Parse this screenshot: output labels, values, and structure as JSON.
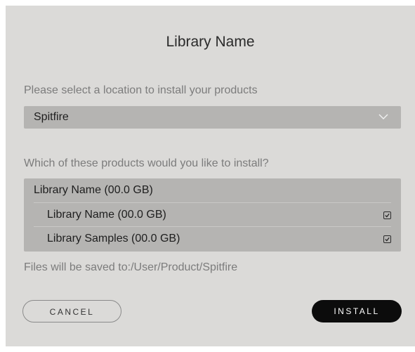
{
  "dialog": {
    "title": "Library Name",
    "location_prompt": "Please select a location to install your products",
    "location_select": {
      "value": "Spitfire",
      "icon": "chevron-down-icon"
    },
    "products_prompt": "Which of these products would you like to install?",
    "products": {
      "group_label": "Library Name (00.0 GB)",
      "items": [
        {
          "label": "Library Name (00.0 GB)",
          "checked": true
        },
        {
          "label": "Library Samples (00.0 GB)",
          "checked": true
        }
      ]
    },
    "save_path": "Files will be saved to:/User/Product/Spitfire",
    "cancel_label": "CANCEL",
    "install_label": "INSTALL"
  },
  "colors": {
    "dialog_bg": "#dbdad8",
    "control_bg": "#b5b4b2",
    "primary_button": "#0c0c0c",
    "muted_text": "#7c7c7c"
  }
}
